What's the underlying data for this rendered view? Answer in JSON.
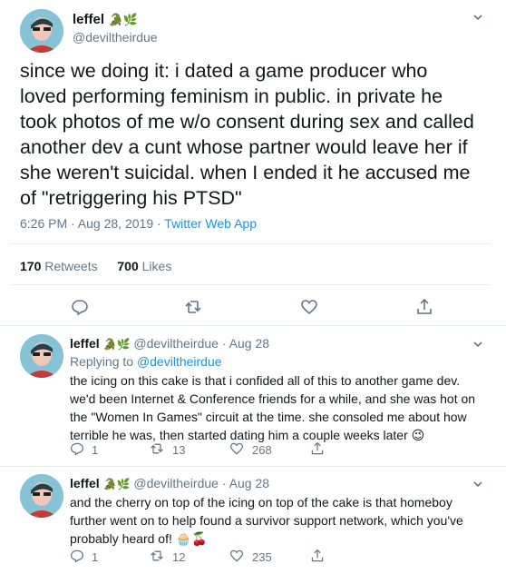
{
  "main_tweet": {
    "name": "leffel",
    "handle": "@deviltheirdue",
    "text": "since we doing it: i dated a game producer who loved performing feminism in public. in private he took photos of me w/o consent during sex and called another dev a cunt whose partner would leave her if she weren't suicidal. when I ended it he accused me of \"retriggering his PTSD\"",
    "time": "6:26 PM · Aug 28, 2019 · ",
    "source": "Twitter Web App",
    "retweets_count": "170",
    "retweets_label": "Retweets",
    "likes_count": "700",
    "likes_label": "Likes"
  },
  "replies": [
    {
      "name": "leffel",
      "handle": "@deviltheirdue",
      "date": " · Aug 28",
      "replying_prefix": "Replying to ",
      "replying_handle": "@deviltheirdue",
      "text": "the icing on this cake is that i confided all of this to another game dev. we'd been Internet & Conference friends for a while, and she was hot on the \"Women In Games\" circuit at the time. she consoled me about how terrible he was, then started dating him a couple weeks later 😉",
      "replies": "1",
      "retweets": "13",
      "likes": "268"
    },
    {
      "name": "leffel",
      "handle": "@deviltheirdue",
      "date": " · Aug 28",
      "text": "and the cherry on top of the icing on top of the cake is that homeboy further went on to help found a survivor support network, which you've probably heard of! 🧁🍒",
      "replies": "1",
      "retweets": "12",
      "likes": "235"
    }
  ],
  "name_emoji": "🐊🌿",
  "colors": {
    "link": "#1b95e0",
    "muted": "#657786",
    "text": "#14171a",
    "divider": "#e6ecf0"
  },
  "icons": [
    "reply-icon",
    "retweet-icon",
    "like-icon",
    "share-icon",
    "chevron-down-icon"
  ]
}
